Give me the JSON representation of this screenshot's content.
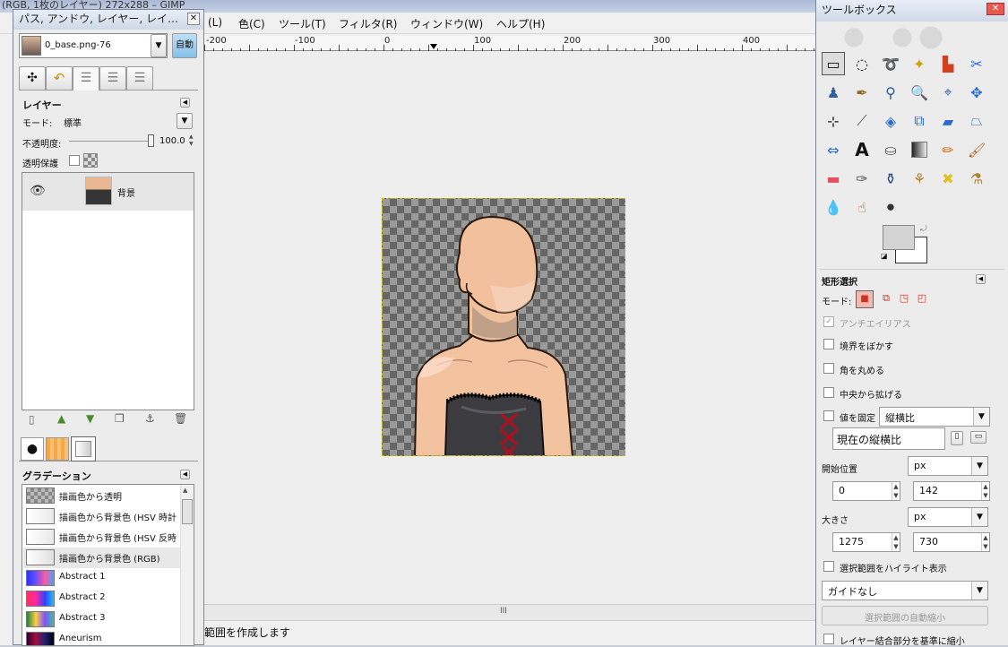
{
  "main": {
    "title": "(RGB, 1枚のレイヤー) 272x288 – GIMP",
    "menus": [
      "(L)",
      "色(C)",
      "ツール(T)",
      "フィルタ(R)",
      "ウィンドウ(W)",
      "ヘルプ(H)"
    ],
    "ruler_labels": [
      "-200",
      "-100",
      "0",
      "100",
      "200",
      "300",
      "400"
    ],
    "status": "範囲を作成します",
    "scroll_grip": "III"
  },
  "dock": {
    "title": "パス, アンドウ, レイヤー, レイ…",
    "image_selector": "0_base.png-76",
    "auto_button": "自動",
    "layers_header": "レイヤー",
    "mode_label": "モード:",
    "mode_value": "標準",
    "opacity_label": "不透明度:",
    "opacity_value": "100.0",
    "opacity_level": 1.0,
    "lock_label": "透明保護",
    "layer_name": "背景",
    "gradient_header": "グラデーション",
    "gradients": [
      {
        "name": "描画色から透明",
        "css": "checker"
      },
      {
        "name": "描画色から背景色 (HSV 時計",
        "css": "linear-gradient(90deg,#ffffff,#e8e8e8)"
      },
      {
        "name": "描画色から背景色 (HSV 反時",
        "css": "linear-gradient(90deg,#ffffff,#e8e8e8)"
      },
      {
        "name": "描画色から背景色 (RGB)",
        "css": "linear-gradient(90deg,#ffffff,#e0e0e0)"
      },
      {
        "name": "Abstract 1",
        "css": "linear-gradient(90deg,#2a33ff,#6a4fff,#ff5aa0,#4aa0ff)"
      },
      {
        "name": "Abstract 2",
        "css": "linear-gradient(90deg,#ff3060,#ff2aa0,#3040ff,#20c0ff)"
      },
      {
        "name": "Abstract 3",
        "css": "linear-gradient(90deg,#208040,#ffd040,#8050ff,#40c0a0)"
      },
      {
        "name": "Aneurism",
        "css": "linear-gradient(90deg,#300030,#a01040,#202070,#000010)"
      }
    ]
  },
  "toolbox": {
    "title": "ツールボックス",
    "options_header": "矩形選択",
    "mode_label": "モード:",
    "antialias": "アンチエイリアス",
    "feather": "境界をぼかす",
    "round": "角を丸める",
    "expand": "中央から拡げる",
    "fixed": "値を固定",
    "fixed_value": "縦横比",
    "current_ratio": "現在の縦横比",
    "position_label": "開始位置",
    "pos_unit": "px",
    "pos_x": "0",
    "pos_y": "142",
    "size_label": "大きさ",
    "size_unit": "px",
    "size_w": "1275",
    "size_h": "730",
    "highlight": "選択範囲をハイライト表示",
    "guides": "ガイドなし",
    "autoshrink": "選択範囲の自動縮小",
    "merged": "レイヤー結合部分を基準に縮小"
  },
  "colors": {
    "fg": "#000000",
    "bg": "#ffffff",
    "fg_swatch": "#d4d4d4",
    "accent": "#c9b300"
  }
}
